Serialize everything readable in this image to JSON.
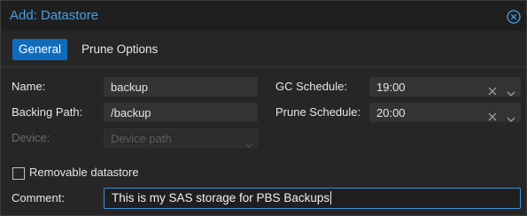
{
  "dialog": {
    "title": "Add: Datastore"
  },
  "tabs": [
    {
      "label": "General",
      "active": true
    },
    {
      "label": "Prune Options",
      "active": false
    }
  ],
  "form": {
    "name": {
      "label": "Name:",
      "value": "backup"
    },
    "backing_path": {
      "label": "Backing Path:",
      "value": "/backup"
    },
    "device": {
      "label": "Device:",
      "placeholder": "Device path",
      "disabled": true
    },
    "gc_schedule": {
      "label": "GC Schedule:",
      "value": "19:00"
    },
    "prune_schedule": {
      "label": "Prune Schedule:",
      "value": "20:00"
    },
    "removable": {
      "label": "Removable datastore",
      "checked": false
    },
    "comment": {
      "label": "Comment:",
      "value": "This is my SAS storage for PBS Backups"
    }
  },
  "icons": {
    "close": "circle-x-icon",
    "clear": "x-icon",
    "dropdown": "chevron-down-icon"
  },
  "colors": {
    "accent": "#4a9fe6",
    "active_tab": "#0f6cbd",
    "focus_border": "#3f8fd6",
    "background": "#262626"
  }
}
